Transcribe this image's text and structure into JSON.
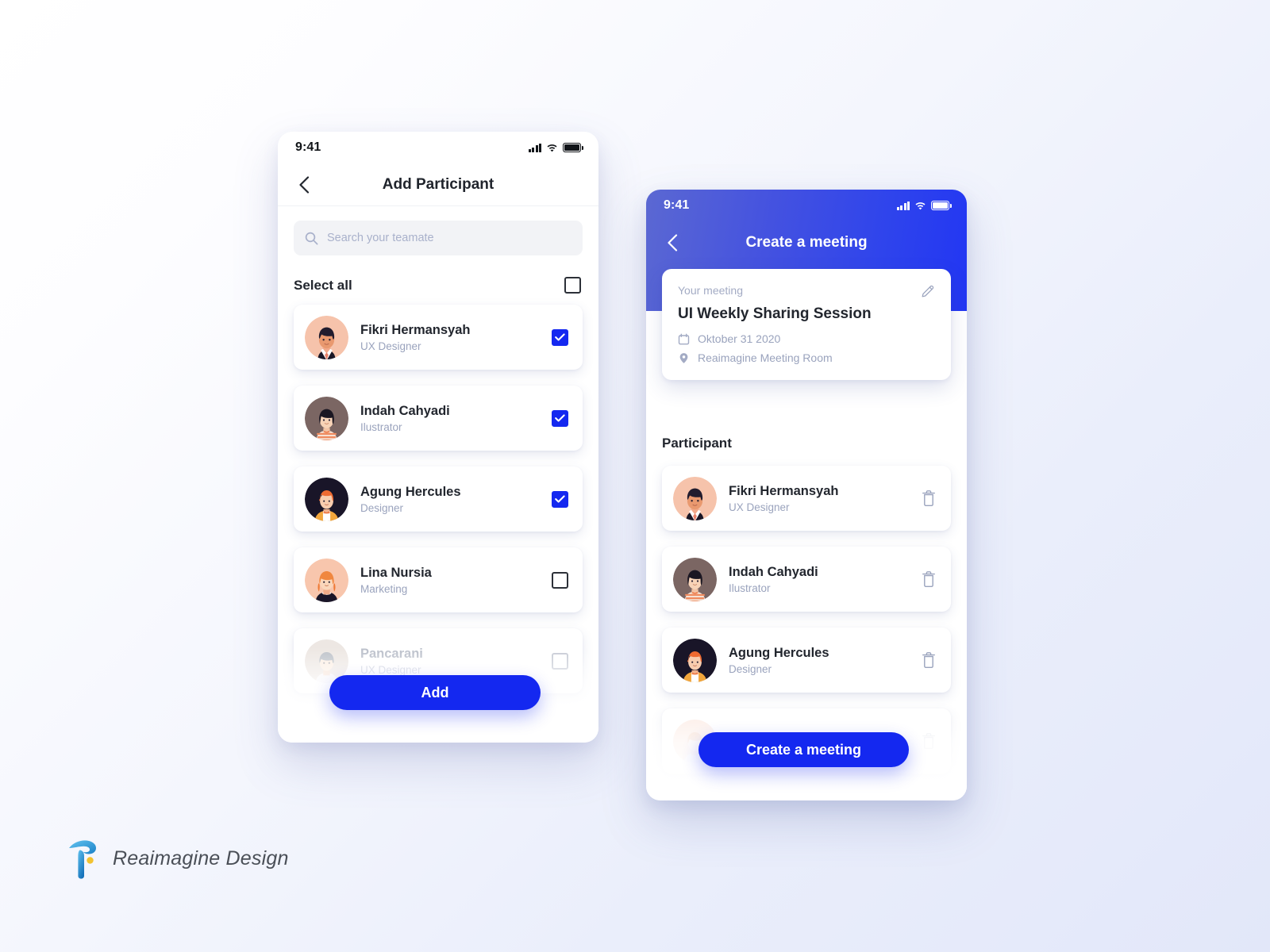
{
  "background": {
    "gradient_from": "#ffffff",
    "gradient_to": "#e2e7f9"
  },
  "theme": {
    "accent_blue": "#1428f0",
    "header_gradient_from": "#5b68d2",
    "header_gradient_to": "#2236f3",
    "text_primary": "#22262e",
    "text_muted": "#9aa3bd",
    "search_bg": "#f2f3f6"
  },
  "screen_add_participant": {
    "status_bar": {
      "time": "9:41",
      "signal_icon": "cellular-signal-icon",
      "wifi_icon": "wifi-icon",
      "battery_icon": "battery-full-icon"
    },
    "nav": {
      "back_icon": "chevron-left-icon",
      "title": "Add Participant"
    },
    "search": {
      "icon": "search-icon",
      "placeholder": "Search your teamate",
      "value": ""
    },
    "select_all": {
      "label": "Select all",
      "checked": false,
      "checkbox_icon": "checkbox-unchecked-icon"
    },
    "people": [
      {
        "name": "Fikri Hermansyah",
        "role": "UX Designer",
        "checked": true,
        "avatar": "avatar-fikri",
        "faded": false
      },
      {
        "name": "Indah Cahyadi",
        "role": "Ilustrator",
        "checked": true,
        "avatar": "avatar-indah",
        "faded": false
      },
      {
        "name": "Agung Hercules",
        "role": "Designer",
        "checked": true,
        "avatar": "avatar-agung",
        "faded": false
      },
      {
        "name": "Lina Nursia",
        "role": "Marketing",
        "checked": false,
        "avatar": "avatar-lina",
        "faded": false
      },
      {
        "name": "Pancarani",
        "role": "UX Designer",
        "checked": false,
        "avatar": "avatar-pancarani",
        "faded": true
      }
    ],
    "primary_button": {
      "label": "Add"
    }
  },
  "screen_create_meeting": {
    "status_bar": {
      "time": "9:41",
      "signal_icon": "cellular-signal-icon",
      "wifi_icon": "wifi-icon",
      "battery_icon": "battery-full-icon"
    },
    "nav": {
      "back_icon": "chevron-left-icon",
      "title": "Create a meeting"
    },
    "meeting_card": {
      "label": "Your meeting",
      "edit_icon": "pencil-edit-icon",
      "title": "UI Weekly Sharing Session",
      "date_icon": "calendar-icon",
      "date": "Oktober 31 2020",
      "location_icon": "map-pin-icon",
      "location": "Reaimagine Meeting Room"
    },
    "participant_heading": "Participant",
    "participants": [
      {
        "name": "Fikri Hermansyah",
        "role": "UX Designer",
        "avatar": "avatar-fikri",
        "delete_icon": "trash-icon",
        "faded": false
      },
      {
        "name": "Indah Cahyadi",
        "role": "Ilustrator",
        "avatar": "avatar-indah",
        "delete_icon": "trash-icon",
        "faded": false
      },
      {
        "name": "Agung Hercules",
        "role": "Designer",
        "avatar": "avatar-agung",
        "delete_icon": "trash-icon",
        "faded": false
      },
      {
        "name": "",
        "role": "",
        "avatar": "avatar-pancarani",
        "delete_icon": "trash-icon",
        "faded": true
      }
    ],
    "primary_button": {
      "label": "Create a meeting"
    }
  },
  "brand": {
    "name": "Reaimagine Design",
    "logo_icon": "reaimagine-r-logo-icon",
    "logo_color": "#3aa0e0",
    "logo_dot_color": "#f2c230"
  }
}
